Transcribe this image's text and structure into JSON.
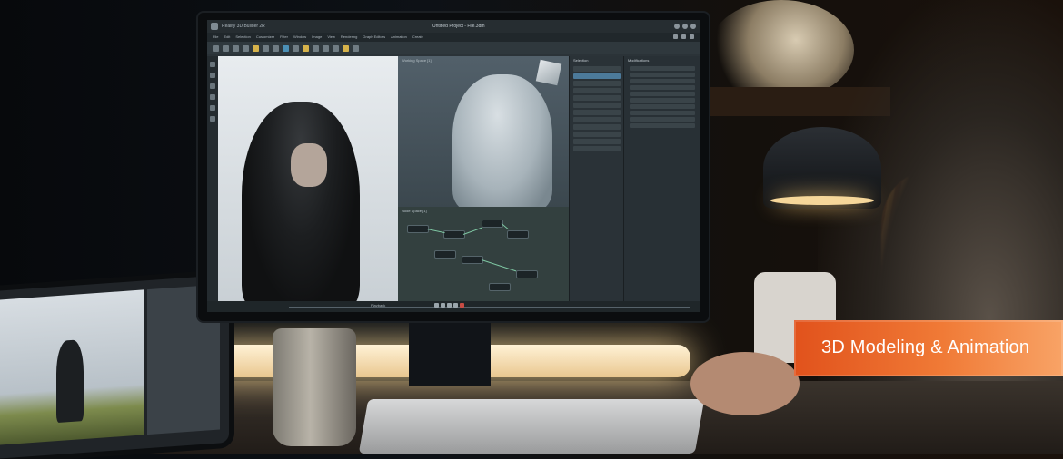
{
  "window": {
    "app_title": "Reality 3D Builder 2R",
    "document_title": "Untitled Project - File.3dm"
  },
  "menu": [
    "File",
    "Edit",
    "Selection",
    "Customizer",
    "Filter",
    "Window",
    "Image",
    "View",
    "Rendering",
    "Graph Editors",
    "Animation",
    "Create"
  ],
  "viewport": {
    "label": "Working Space [1]"
  },
  "node_editor": {
    "label": "Node Space [1]"
  },
  "panels": {
    "selection_header": "Selection",
    "modifiers_header": "Modifications"
  },
  "timeline": {
    "label": "Playback"
  },
  "badge": {
    "text": "3D Modeling & Animation"
  },
  "colors": {
    "badge_start": "#e1521c",
    "badge_end": "#f8a366",
    "ui_bg": "#2b3338"
  }
}
